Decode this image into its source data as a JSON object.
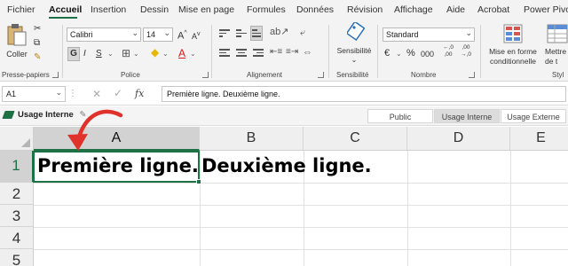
{
  "ribbon_tabs": [
    "Fichier",
    "Accueil",
    "Insertion",
    "Dessin",
    "Mise en page",
    "Formules",
    "Données",
    "Révision",
    "Affichage",
    "Aide",
    "Acrobat",
    "Power Pivot"
  ],
  "active_tab": "Accueil",
  "clipboard": {
    "paste_label": "Coller",
    "group_label": "Presse-papiers"
  },
  "font": {
    "name": "Calibri",
    "size": "14",
    "bold": "G",
    "italic": "I",
    "underline": "S",
    "grow": "A",
    "shrink": "A",
    "color_letter": "A",
    "group_label": "Police"
  },
  "alignment": {
    "group_label": "Alignement"
  },
  "sensitivity": {
    "button_label": "Sensibilité",
    "group_label": "Sensibilité"
  },
  "number": {
    "format": "Standard",
    "group_label": "Nombre",
    "currency": "€",
    "percent": "%",
    "thousands": "000",
    "inc_dec": "←,0 ,00",
    "dec_dec": ",00 →,0"
  },
  "styles": {
    "cond_format_line1": "Mise en forme",
    "cond_format_line2": "conditionnelle",
    "table_format_line1": "Mettre",
    "table_format_line2": "de t",
    "group_label": "Styl"
  },
  "formula_bar": {
    "name_box": "A1",
    "fx": "fx",
    "content": "Première ligne. Deuxième ligne."
  },
  "sensitivity_bar": {
    "current_label": "Usage Interne",
    "options": [
      "Public",
      "Usage Interne",
      "Usage Externe"
    ],
    "active_option": "Usage Interne"
  },
  "grid": {
    "columns": [
      "A",
      "B",
      "C",
      "D",
      "E"
    ],
    "rows": [
      "1",
      "2",
      "3",
      "4",
      "5"
    ],
    "active_cell": "A1",
    "cells": {
      "A1": "Première ligne.",
      "B1": "Deuxième ligne."
    }
  },
  "colors": {
    "accent": "#1e7145",
    "annotation_arrow": "#e0322b"
  }
}
